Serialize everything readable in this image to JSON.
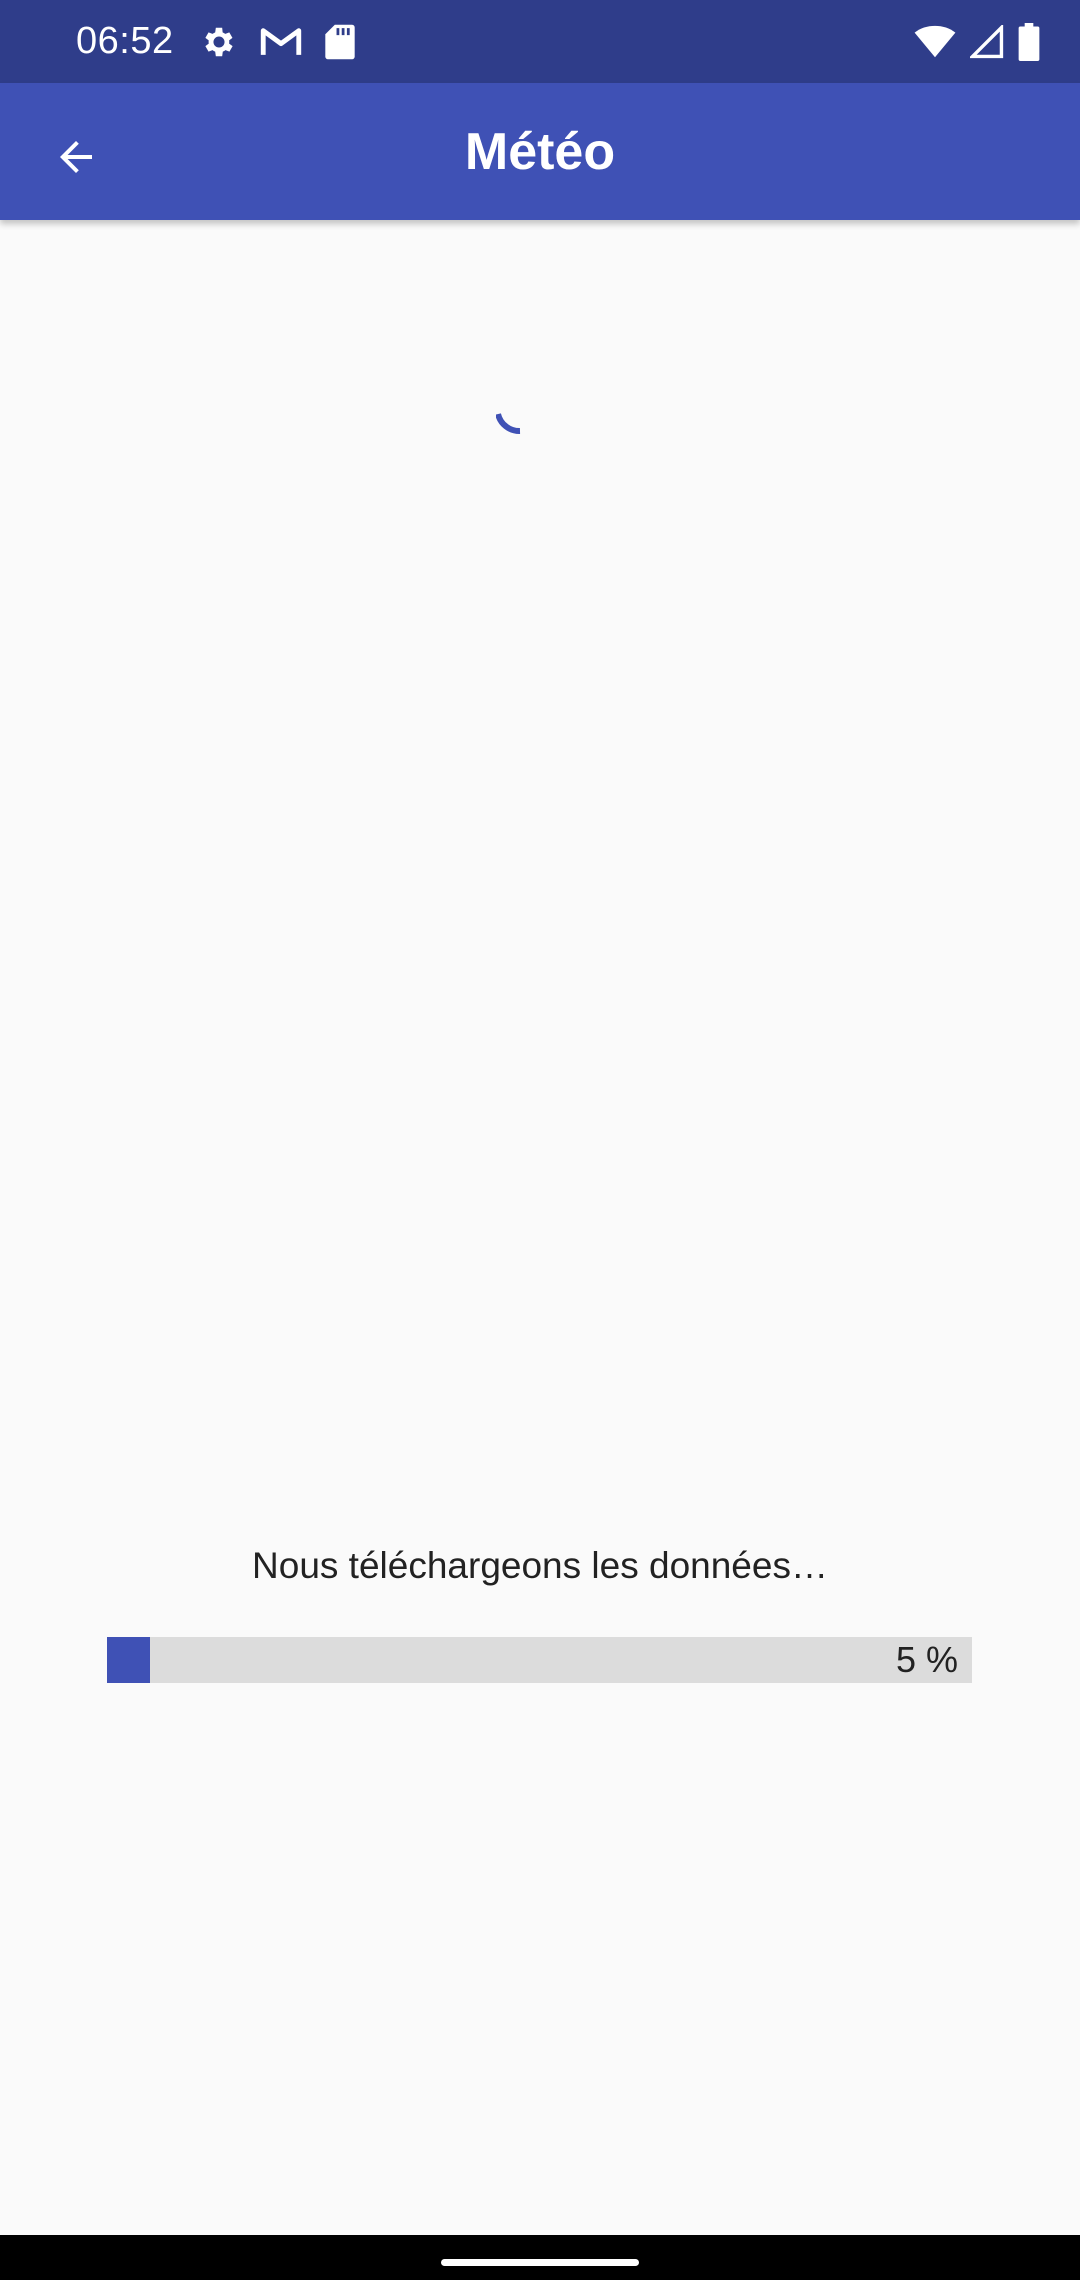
{
  "status_bar": {
    "time": "06:52",
    "icons_left": [
      "gear-icon",
      "gmail-icon",
      "sd-card-icon"
    ],
    "icons_right": [
      "wifi-icon",
      "signal-icon",
      "battery-icon"
    ]
  },
  "app_bar": {
    "title": "Météo",
    "back_icon": "arrow-back-icon"
  },
  "loading": {
    "message": "Nous téléchargeons les données…",
    "progress_percent": 5,
    "progress_label": "5 %"
  },
  "colors": {
    "status_bar": "#2f3d8a",
    "primary": "#3f51b5",
    "track": "#dcdcdc",
    "background": "#fafafa"
  }
}
